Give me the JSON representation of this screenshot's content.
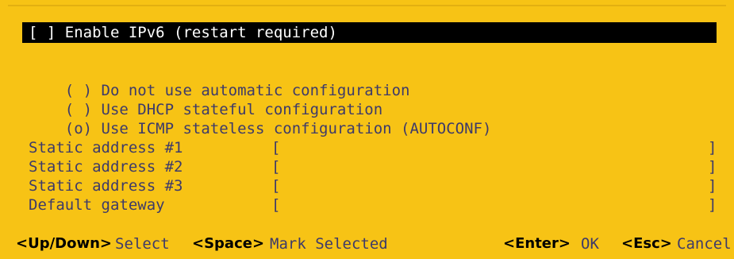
{
  "ipv6_toggle": {
    "label": "[ ] Enable IPv6 (restart required)"
  },
  "config_options": [
    {
      "label": "( ) Do not use automatic configuration"
    },
    {
      "label": "( ) Use DHCP stateful configuration"
    },
    {
      "label": "(o) Use ICMP stateless configuration (AUTOCONF)"
    }
  ],
  "fields": [
    {
      "label": "Static address #1",
      "open": "[",
      "close": "]",
      "value": ""
    },
    {
      "label": "Static address #2",
      "open": "[",
      "close": "]",
      "value": ""
    },
    {
      "label": "Static address #3",
      "open": "[",
      "close": "]",
      "value": ""
    },
    {
      "label": "Default gateway",
      "open": "[",
      "close": "]",
      "value": ""
    }
  ],
  "footer": {
    "updown_key": "<Up/Down>",
    "updown_desc": "Select",
    "space_key": "<Space>",
    "space_desc": "Mark Selected",
    "enter_key": "<Enter>",
    "enter_desc": "OK",
    "esc_key": "<Esc>",
    "esc_desc": "Cancel"
  },
  "colors": {
    "background": "#f7c315",
    "text": "#3d3a6a",
    "highlight_bg": "#000000",
    "highlight_text": "#ffffff"
  }
}
